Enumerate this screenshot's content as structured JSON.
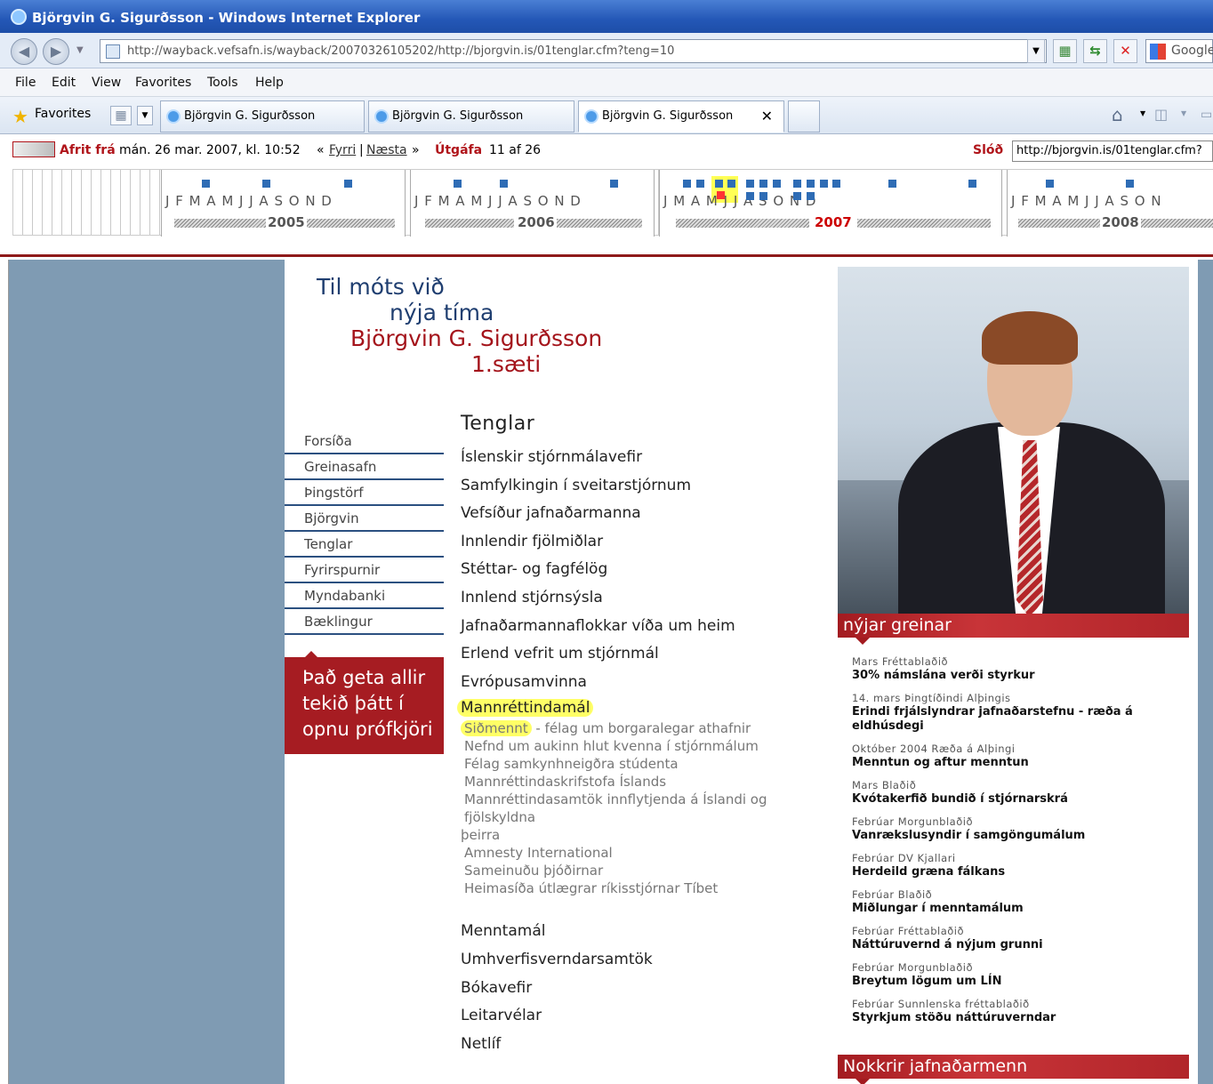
{
  "window": {
    "title": "Björgvin G. Sigurðsson - Windows Internet Explorer"
  },
  "address": {
    "url": "http://wayback.vefsafn.is/wayback/20070326105202/http://bjorgvin.is/01tenglar.cfm?teng=10"
  },
  "search": {
    "placeholder": "Google"
  },
  "menu": [
    "File",
    "Edit",
    "View",
    "Favorites",
    "Tools",
    "Help"
  ],
  "favorites": {
    "label": "Favorites"
  },
  "tabs": [
    {
      "label": "Björgvin G. Sigurðsson"
    },
    {
      "label": "Björgvin G. Sigurðsson"
    },
    {
      "label": "Björgvin G. Sigurðsson"
    }
  ],
  "wayback": {
    "copy_label": "Afrit frá",
    "date": "mán. 26 mar. 2007, kl. 10:52",
    "prev": "Fyrri",
    "next": "Næsta",
    "version_label": "Útgáfa",
    "version": "11 af 26",
    "url_label": "Slóð",
    "url_value": "http://bjorgvin.is/01tenglar.cfm?",
    "years": [
      {
        "year": "2005",
        "months": "J F  M A M  J J A S  O N D"
      },
      {
        "year": "2006",
        "months": "J F  M A  M J J A S O  N D"
      },
      {
        "year": "2007",
        "months": "J        M    A       M J J  A S O N  D"
      },
      {
        "year": "2008",
        "months": "J F  M A M J  J A S O N"
      }
    ],
    "current_month": "M"
  },
  "site": {
    "headline": [
      "Til móts við",
      "nýja tíma",
      "Björgvin G. Sigurðsson",
      "1.sæti"
    ],
    "nav": [
      "Forsíða",
      "Greinasafn",
      "Þingstörf",
      "Björgvin",
      "Tenglar",
      "Fyrirspurnir",
      "Myndabanki",
      "Bæklingur"
    ],
    "promo": [
      "Það geta allir",
      "tekið þátt í",
      "opnu prófkjöri"
    ],
    "links_title": "Tenglar",
    "categories_top": [
      "Íslenskir stjórnmálavefir",
      "Samfylkingin í sveitarstjórnum",
      "Vefsíður jafnaðarmanna",
      "Innlendir fjölmiðlar",
      "Stéttar- og fagfélög",
      "Innlend stjórnsýsla",
      "Jafnaðarmannaflokkar víða um heim",
      "Erlend vefrit um stjórnmál",
      "Evrópusamvinna"
    ],
    "active_category": "Mannréttindamál",
    "subs": {
      "first_link": "Siðmennt",
      "first_rest": " - félag um borgaralegar athafnir",
      "items": [
        "Nefnd um aukinn hlut kvenna í stjórnmálum",
        "Félag samkynhneigðra stúdenta",
        "Mannréttindaskrifstofa Íslands",
        "Mannréttindasamtök innflytjenda á Íslandi og fjölskyldna"
      ],
      "wrap": "þeirra",
      "items2": [
        "Amnesty International",
        "Sameinuðu þjóðirnar",
        "Heimasíða útlægrar ríkisstjórnar Tíbet"
      ]
    },
    "categories_bottom": [
      "Menntamál",
      "Umhverfisverndarsamtök",
      "Bókavefir",
      "Leitarvélar",
      "Netlíf"
    ],
    "news_title": "nýjar greinar",
    "news": [
      {
        "src": "Mars Fréttablaðið",
        "title": "30% námslána verði styrkur"
      },
      {
        "src": "14. mars Þingtíðindi Alþingis",
        "title": "Erindi frjálslyndrar jafnaðarstefnu - ræða á eldhúsdegi"
      },
      {
        "src": "Október 2004 Ræða á Alþingi",
        "title": "Menntun og aftur menntun"
      },
      {
        "src": "Mars Blaðið",
        "title": "Kvótakerfið bundið í stjórnarskrá"
      },
      {
        "src": "Febrúar Morgunblaðið",
        "title": "Vanrækslusyndir í samgöngumálum"
      },
      {
        "src": "Febrúar DV Kjallari",
        "title": "Herdeild græna fálkans"
      },
      {
        "src": "Febrúar Blaðið",
        "title": "Miðlungar í menntamálum"
      },
      {
        "src": "Febrúar Fréttablaðið",
        "title": "Náttúruvernd á nýjum grunni"
      },
      {
        "src": "Febrúar Morgunblaðið",
        "title": "Breytum lögum um LÍN"
      },
      {
        "src": "Febrúar Sunnlenska fréttablaðið",
        "title": "Styrkjum stöðu náttúruverndar"
      }
    ],
    "bar2_title": "Nokkrir jafnaðarmenn"
  }
}
